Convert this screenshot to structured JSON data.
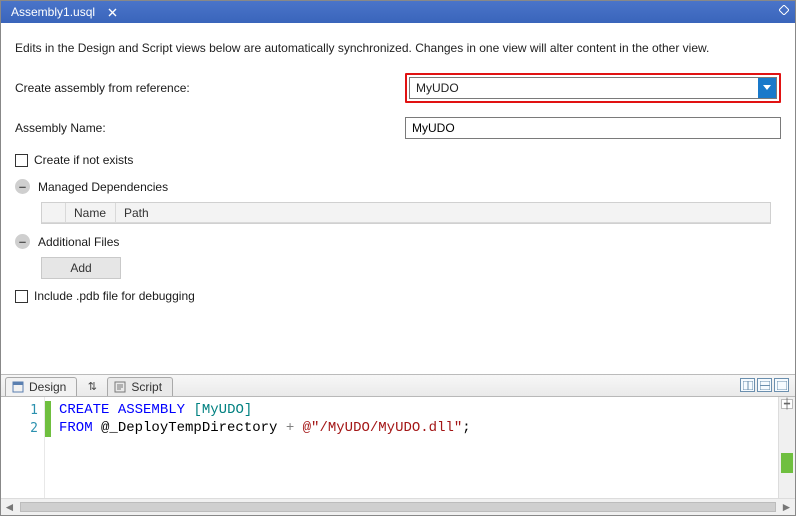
{
  "titlebar": {
    "tab_label": "Assembly1.usql"
  },
  "form": {
    "intro": "Edits in the Design and Script views below are automatically synchronized. Changes in one view will alter content in the other view.",
    "reference_label": "Create assembly from reference:",
    "reference_value": "MyUDO",
    "name_label": "Assembly Name:",
    "name_value": "MyUDO",
    "create_if_not_exists_label": "Create if not exists",
    "create_if_not_exists_checked": false,
    "managed_deps_label": "Managed Dependencies",
    "dep_columns": {
      "name": "Name",
      "path": "Path"
    },
    "additional_files_label": "Additional Files",
    "add_button_label": "Add",
    "include_pdb_label": "Include .pdb file for debugging",
    "include_pdb_checked": false
  },
  "subtabs": {
    "design": "Design",
    "script": "Script"
  },
  "code": {
    "lines": [
      {
        "n": "1"
      },
      {
        "n": "2"
      }
    ],
    "tok": {
      "create": "CREATE",
      "assembly": "ASSEMBLY",
      "lbrack": " [",
      "asm_name": "MyUDO",
      "rbrack": "]",
      "from": "FROM",
      "atvar": " @_DeployTempDirectory ",
      "plus": "+",
      "sp": " ",
      "strlit": "@\"/MyUDO/MyUDO.dll\"",
      "semi": ";"
    }
  }
}
